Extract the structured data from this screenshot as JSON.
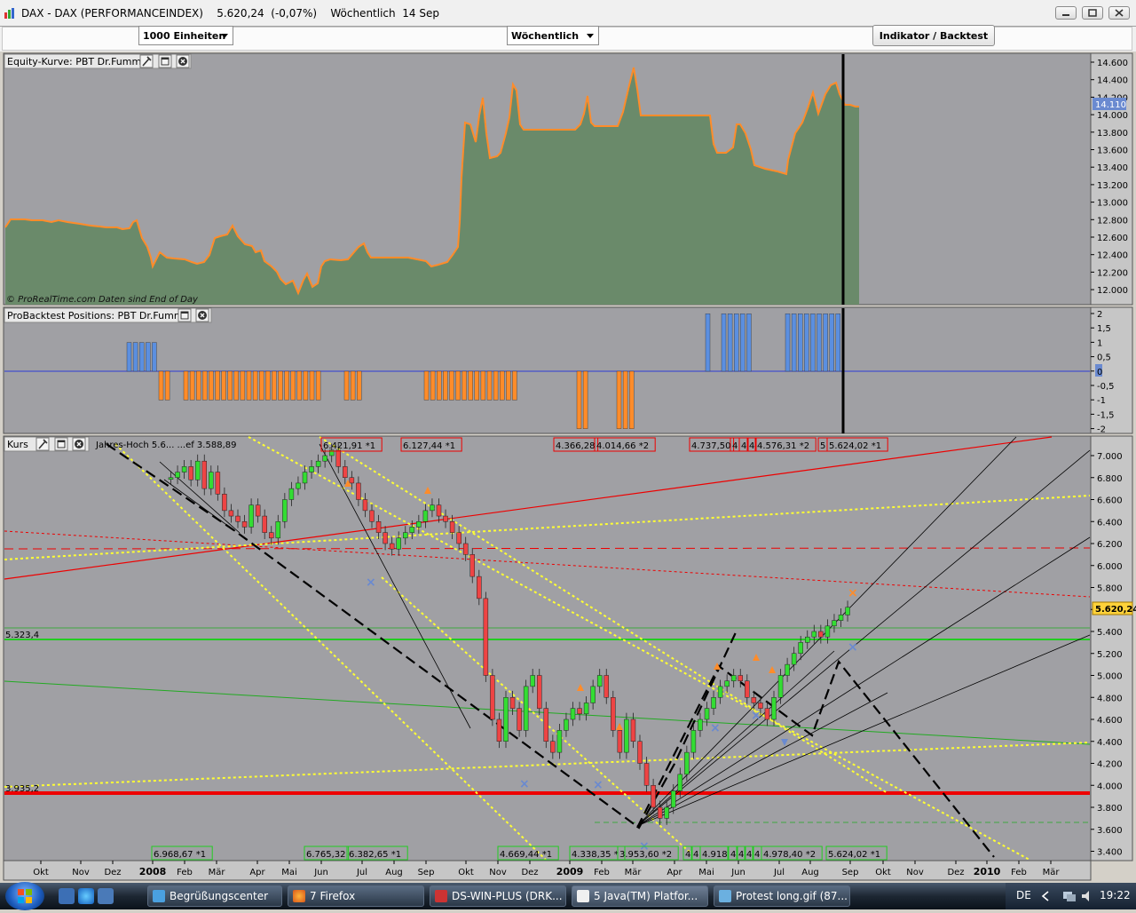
{
  "window": {
    "title": "DAX - DAX (PERFORMANCEINDEX)    5.620,24  (-0,07%)    Wöchentlich  14 Sep"
  },
  "toolbar": {
    "units_value": "1000 Einheiten",
    "period_value": "Wöchentlich",
    "indicator_button": "Indikator / Backtest"
  },
  "panels": {
    "equity": {
      "title": "Equity-Kurve: PBT Dr.Fummel",
      "footer": "© ProRealTime.com  Daten sind End of Day",
      "last_value": "14.110",
      "axis_labels": [
        "14.600",
        "14.400",
        "14.200",
        "14.000",
        "13.800",
        "13.600",
        "13.400",
        "13.200",
        "13.000",
        "12.800",
        "12.600",
        "12.400",
        "12.200",
        "12.000"
      ],
      "colors": {
        "fill": "#6a8a6a",
        "up": "#5b8fe0",
        "down": "#ff8c2a"
      }
    },
    "positions": {
      "title": "ProBacktest Positions: PBT Dr.Fummel",
      "axis_labels": [
        "2",
        "1,5",
        "1",
        "0,5",
        "0",
        "-0,5",
        "-1",
        "-1,5",
        "-2"
      ],
      "colors": {
        "long": "#5b8fe0",
        "short": "#ff8c2a"
      }
    },
    "price": {
      "title": "Kurs",
      "year_high": "Jahres-Hoch 5.6...  ...ef 3.588,89",
      "axis_labels": [
        "7.000",
        "6.800",
        "6.600",
        "6.400",
        "6.200",
        "6.000",
        "5.800",
        "5.600",
        "5.400",
        "5.200",
        "5.000",
        "4.800",
        "4.600",
        "4.400",
        "4.200",
        "4.000",
        "3.800",
        "3.600",
        "3.400"
      ],
      "last_price": "5.620,24",
      "level_upper": "5.323,4",
      "level_lower": "3.935,2",
      "top_labels": [
        "6.421,91 *1",
        "6.127,44 *1",
        "4.366,28",
        "4.014,66 *2",
        "4.737,50",
        "4",
        "4",
        "4",
        "4.576,31 *2",
        "5",
        "5.624,02 *1"
      ],
      "bottom_labels": [
        "6.968,67 *1",
        "6.765,32",
        "6.382,65 *1",
        "4.669,44 *1",
        "4.338,35 *",
        "3.953,60 *2",
        "4",
        "4",
        "4.918",
        "4",
        "4",
        "4",
        "4",
        "4.978,40 *2",
        "5.624,02 *1"
      ]
    }
  },
  "time_axis": [
    "Okt",
    "Nov",
    "Dez",
    "2008",
    "Feb",
    "Mär",
    "Apr",
    "Mai",
    "Jun",
    "Jul",
    "Aug",
    "Sep",
    "Okt",
    "Nov",
    "Dez",
    "2009",
    "Feb",
    "Mär",
    "Apr",
    "Mai",
    "Jun",
    "Jul",
    "Aug",
    "Sep",
    "Okt",
    "Nov",
    "Dez",
    "2010",
    "Feb",
    "Mär"
  ],
  "taskbar": {
    "tasks": [
      "Begrüßungscenter",
      "7 Firefox",
      "DS-WIN-PLUS (DRK...",
      "5 Java(TM) Platfor...",
      "Protest long.gif (87..."
    ],
    "language": "DE",
    "clock": "19:22"
  }
}
